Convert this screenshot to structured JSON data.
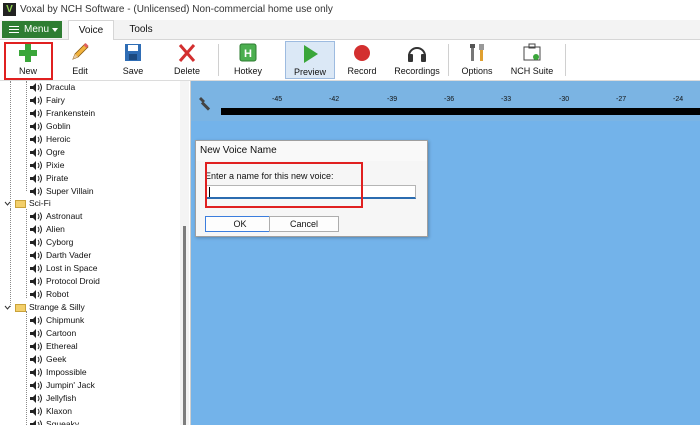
{
  "window": {
    "logo": "V",
    "title": "Voxal by NCH Software - (Unlicensed) Non-commercial home use only"
  },
  "tabbar": {
    "menu_label": "Menu",
    "tabs": [
      {
        "label": "Voice",
        "selected": true
      },
      {
        "label": "Tools",
        "selected": false
      }
    ]
  },
  "toolbar": {
    "buttons": [
      {
        "label": "New",
        "icon": "plus-icon",
        "highlighted": true
      },
      {
        "label": "Edit",
        "icon": "pencil-icon"
      },
      {
        "label": "Save",
        "icon": "floppy-disk-icon"
      },
      {
        "label": "Delete",
        "icon": "red-x-icon"
      },
      {
        "label": "Hotkey",
        "icon": "hotkey-h-icon"
      },
      {
        "label": "Preview",
        "icon": "play-icon",
        "active": true
      },
      {
        "label": "Record",
        "icon": "record-dot-icon"
      },
      {
        "label": "Recordings",
        "icon": "headphones-icon"
      },
      {
        "label": "Options",
        "icon": "tools-icon"
      },
      {
        "label": "NCH Suite",
        "icon": "suite-icon"
      }
    ]
  },
  "tree": {
    "voices_top": [
      "Dracula",
      "Fairy",
      "Frankenstein",
      "Goblin",
      "Heroic",
      "Ogre",
      "Pixie",
      "Pirate",
      "Super Villain"
    ],
    "folder_scifi": "Sci-Fi",
    "voices_scifi": [
      "Astronaut",
      "Alien",
      "Cyborg",
      "Darth Vader",
      "Lost in Space",
      "Protocol Droid",
      "Robot"
    ],
    "folder_strange": "Strange & Silly",
    "voices_strange": [
      "Chipmunk",
      "Cartoon",
      "Ethereal",
      "Geek",
      "Impossible",
      "Jumpin' Jack",
      "Jellyfish",
      "Klaxon",
      "Squeaky"
    ]
  },
  "ruler": {
    "ticks": [
      "-45",
      "-42",
      "-39",
      "-36",
      "-33",
      "-30",
      "-27",
      "-24"
    ]
  },
  "dialog": {
    "title": "New Voice Name",
    "prompt": "Enter a name for this new voice:",
    "input_value": "",
    "ok_label": "OK",
    "cancel_label": "Cancel"
  },
  "colors": {
    "menu_green": "#2e7d32",
    "waveform_blue": "#73b3ea",
    "ruler_blue": "#7bb4e3",
    "highlight_red": "#e02020"
  }
}
